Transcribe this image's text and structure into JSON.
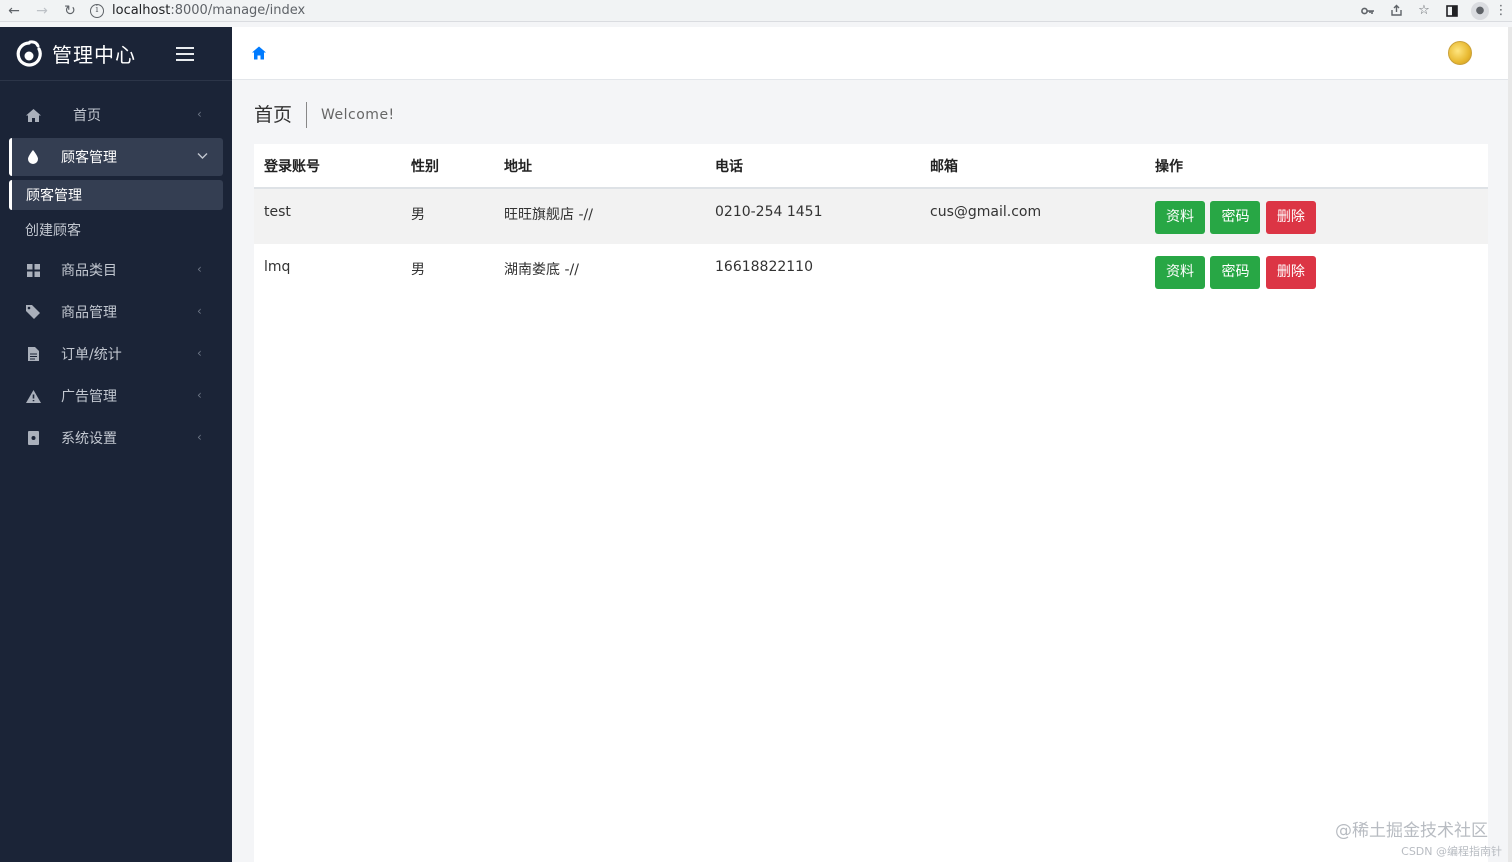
{
  "browser": {
    "url_host": "localhost",
    "url_path": ":8000/manage/index"
  },
  "sidebar": {
    "brand": "管理中心",
    "items": [
      {
        "label": "首页",
        "icon": "home-icon"
      },
      {
        "label": "顾客管理",
        "icon": "drop-icon",
        "expanded": true,
        "children": [
          {
            "label": "顾客管理",
            "active": true
          },
          {
            "label": "创建顾客"
          }
        ]
      },
      {
        "label": "商品类目",
        "icon": "grid-icon"
      },
      {
        "label": "商品管理",
        "icon": "tag-icon"
      },
      {
        "label": "订单/统计",
        "icon": "document-icon"
      },
      {
        "label": "广告管理",
        "icon": "warning-icon"
      },
      {
        "label": "系统设置",
        "icon": "book-icon"
      }
    ]
  },
  "content": {
    "title": "首页",
    "subtitle": "Welcome!"
  },
  "table": {
    "headers": [
      "登录账号",
      "性别",
      "地址",
      "电话",
      "邮箱",
      "操作"
    ],
    "rows": [
      {
        "account": "test",
        "gender": "男",
        "address": "旺旺旗舰店 -//",
        "phone": "0210-254 1451",
        "email": "cus@gmail.com"
      },
      {
        "account": "lmq",
        "gender": "男",
        "address": "湖南娄底 -//",
        "phone": "16618822110",
        "email": ""
      }
    ],
    "actions": {
      "profile": "资料",
      "password": "密码",
      "delete": "删除"
    }
  },
  "watermark": {
    "main": "@稀土掘金技术社区",
    "sub": "CSDN @编程指南针"
  },
  "colors": {
    "sidebar_bg": "#1b2437",
    "success": "#28a745",
    "danger": "#dc3545",
    "link": "#007bff"
  }
}
